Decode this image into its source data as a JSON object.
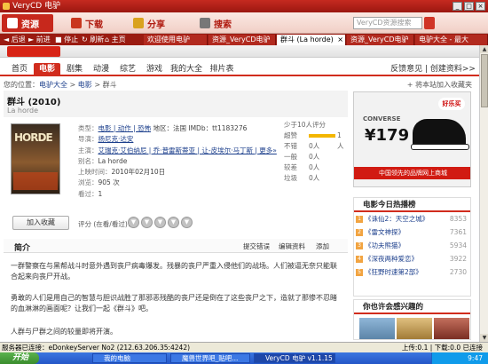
{
  "window": {
    "title": "VeryCD 电驴"
  },
  "toolbar": {
    "home": "资源",
    "download": "下载",
    "share": "分享",
    "search": "搜索",
    "search_placeholder": "VeryCD资源搜索"
  },
  "nav": {
    "back": "后退",
    "forward": "前进",
    "stop": "停止",
    "refresh": "刷新",
    "homepage": "主页"
  },
  "tabs": [
    {
      "label": "欢迎使用电驴"
    },
    {
      "label": "资源_VeryCD电驴"
    },
    {
      "label": "群斗 (La horde)"
    },
    {
      "label": "资源_VeryCD电驴"
    },
    {
      "label": "电驴大全 - 最大"
    }
  ],
  "site_nav": {
    "items": [
      "首页",
      "电影",
      "剧集",
      "动漫",
      "综艺",
      "游戏",
      "我的大全",
      "排片表"
    ],
    "feedback": "反馈意见 | 创建资料>>"
  },
  "breadcrumb": {
    "prefix": "您的位置：",
    "items": [
      "电驴大全",
      "电影",
      "群斗"
    ],
    "note": "+ 将本站加入收藏夹"
  },
  "movie": {
    "title": "群斗 (2010)",
    "original_title": "La horde",
    "poster_text": "HORDE",
    "fields": [
      {
        "label": "类型：",
        "value": "电影 | 动作 | 恐怖",
        "extra": "地区：法国  IMDb：tt1183276"
      },
      {
        "label": "导演：",
        "value": "扬尼克·达安"
      },
      {
        "label": "主演：",
        "value": "艾瑞克·艾伯纳尼 | 乔·普雷斯蒂亚 | 让-皮埃尔·马丁斯 | 更多»"
      },
      {
        "label": "别名：",
        "value": "La horde"
      },
      {
        "label": "上映时间：",
        "value": "2010年02月10日"
      },
      {
        "label": "浏览：",
        "value": "905 次"
      },
      {
        "label": "看过：",
        "value": "1"
      }
    ]
  },
  "rating": {
    "summary": "少于10人评分",
    "rows": [
      {
        "label": "超赞",
        "count": "1人",
        "fraction": 1.0
      },
      {
        "label": "不错",
        "count": "0人",
        "fraction": 0
      },
      {
        "label": "一般",
        "count": "0人",
        "fraction": 0
      },
      {
        "label": "较差",
        "count": "0人",
        "fraction": 0
      },
      {
        "label": "垃圾",
        "count": "0人",
        "fraction": 0
      }
    ]
  },
  "actions": {
    "add_fav": "加入收藏",
    "rate_label": "评分 (在看/看过)："
  },
  "synopsis": {
    "title": "简介",
    "correct": "提交错误",
    "edit": "编辑资料",
    "add": "添加",
    "paragraphs": [
      "一群警察在与黑帮战斗时意外遇到丧尸病毒爆发。残暴的丧尸严重入侵他们的战场。人们被逼无奈只能联合起来向丧尸开战。",
      "勇敢的人们是用自己的智慧与胆识战胜了那邪恶残酷的丧尸还是倒在了这些丧尸之下，造就了那惨不忍睹的血淋淋的画面呢？让我们一起《群斗》吧。",
      "人群与尸群之间的较量即将开演。"
    ]
  },
  "ad": {
    "brand": "CONVERSE",
    "price": "¥179",
    "stamp": "好乐买",
    "banner": "中国领先的品牌网上商城"
  },
  "hot": {
    "title": "电影今日热播榜",
    "items": [
      {
        "name": "《诛仙2：天空之城》",
        "count": "8353"
      },
      {
        "name": "《雷文神探》",
        "count": "7361"
      },
      {
        "name": "《功夫熊猫》",
        "count": "5934"
      },
      {
        "name": "《深夜两种爱恋》",
        "count": "3922"
      },
      {
        "name": "《狂野时速第2部》",
        "count": "2730"
      }
    ]
  },
  "like": {
    "title": "你也许会感兴趣的"
  },
  "status": {
    "left": "服务器已连接：eDonkeyServer No2 (212.63.206.35:4242)",
    "right": "上传:0.1 | 下载:0.0   已连接"
  },
  "taskbar": {
    "start": "开始",
    "tasks": [
      "我的电脑",
      "魔兽世界吧_贴吧...",
      "VeryCD 电驴 v1.1.15"
    ],
    "clock": "9:47"
  },
  "colors": {
    "brand_red": "#d12c1d",
    "title_red": "#9b1710"
  }
}
